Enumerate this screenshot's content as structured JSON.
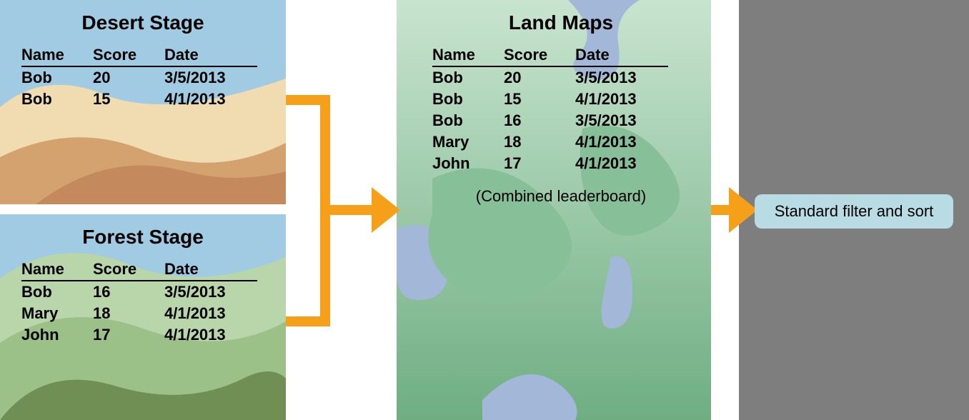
{
  "desert": {
    "title": "Desert Stage",
    "headers": [
      "Name",
      "Score",
      "Date"
    ],
    "rows": [
      {
        "name": "Bob",
        "score": "20",
        "date": "3/5/2013"
      },
      {
        "name": "Bob",
        "score": "15",
        "date": "4/1/2013"
      }
    ]
  },
  "forest": {
    "title": "Forest Stage",
    "headers": [
      "Name",
      "Score",
      "Date"
    ],
    "rows": [
      {
        "name": "Bob",
        "score": "16",
        "date": "3/5/2013"
      },
      {
        "name": "Mary",
        "score": "18",
        "date": "4/1/2013"
      },
      {
        "name": "John",
        "score": "17",
        "date": "4/1/2013"
      }
    ]
  },
  "landmaps": {
    "title": "Land Maps",
    "headers": [
      "Name",
      "Score",
      "Date"
    ],
    "rows": [
      {
        "name": "Bob",
        "score": "20",
        "date": "3/5/2013"
      },
      {
        "name": "Bob",
        "score": "15",
        "date": "4/1/2013"
      },
      {
        "name": "Bob",
        "score": "16",
        "date": "3/5/2013"
      },
      {
        "name": "Mary",
        "score": "18",
        "date": "4/1/2013"
      },
      {
        "name": "John",
        "score": "17",
        "date": "4/1/2013"
      }
    ],
    "note": "(Combined leaderboard)"
  },
  "badge": {
    "label": "Standard filter and sort"
  },
  "colors": {
    "orange": "#f6a01a",
    "sky": "#a0cbe2",
    "sand1": "#f1dbb0",
    "sand2": "#d3a26f",
    "sand3": "#c48a5e",
    "forest_sky": "#a0cbe2",
    "forest_far": "#b8d6a9",
    "forest_mid": "#9bc088",
    "forest_near": "#6f8f55",
    "map_bg_top": "#b8dcc4",
    "map_bg_bot": "#7bb88f",
    "map_water": "#a3b7d8",
    "grey": "#7e7e7e",
    "badge_bg": "#b9dbe3"
  }
}
